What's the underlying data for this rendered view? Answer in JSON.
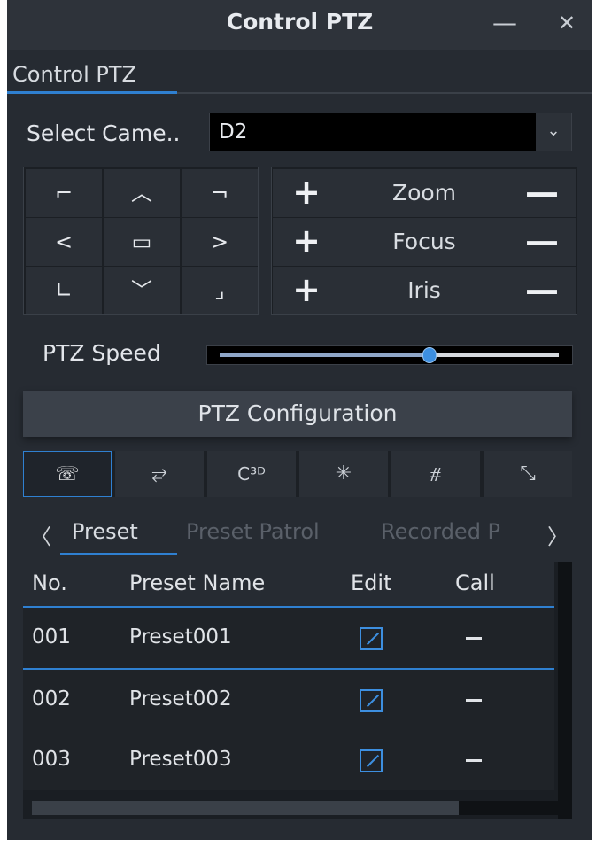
{
  "window": {
    "title": "Control PTZ",
    "minimize_glyph": "—",
    "close_glyph": "✕"
  },
  "tab": {
    "label": "Control PTZ"
  },
  "camera": {
    "label": "Select Came..",
    "value": "D2",
    "dropdown_glyph": "⌄"
  },
  "dpad": {
    "up_left": "⌐",
    "up": "︿",
    "up_right": "¬",
    "left": "<",
    "center": "▭",
    "right": ">",
    "down_left": "∟",
    "down": "﹀",
    "down_right": "⌟"
  },
  "lens": {
    "plus": "+",
    "minus": "—",
    "rows": [
      {
        "label": "Zoom"
      },
      {
        "label": "Focus"
      },
      {
        "label": "Iris"
      }
    ]
  },
  "speed": {
    "label": "PTZ Speed",
    "value": 0.62
  },
  "config_button": {
    "label": "PTZ Configuration"
  },
  "tool_icons": [
    {
      "icon": "preset-icon",
      "glyph": "☏",
      "active": true
    },
    {
      "icon": "patrol-icon",
      "glyph": "⥂",
      "active": false
    },
    {
      "icon": "3d-positioning-icon",
      "glyph": "C³ᴰ",
      "active": false
    },
    {
      "icon": "light-icon",
      "glyph": "✳",
      "active": false
    },
    {
      "icon": "wiper-icon",
      "glyph": "⧣",
      "active": false
    },
    {
      "icon": "auto-focus-icon",
      "glyph": "⤡",
      "active": false
    }
  ],
  "subtabs": {
    "prev_glyph": "〈",
    "next_glyph": "〉",
    "items": [
      {
        "label": "Preset",
        "active": true
      },
      {
        "label": "Preset Patrol",
        "active": false
      },
      {
        "label": "Recorded P",
        "active": false
      }
    ]
  },
  "table": {
    "columns": [
      "No.",
      "Preset Name",
      "Edit",
      "Call"
    ],
    "rows": [
      {
        "no": "001",
        "name": "Preset001"
      },
      {
        "no": "002",
        "name": "Preset002"
      },
      {
        "no": "003",
        "name": "Preset003"
      }
    ]
  },
  "colors": {
    "accent": "#2f80d1",
    "background": "#262b32",
    "text": "#e0e3e7"
  }
}
